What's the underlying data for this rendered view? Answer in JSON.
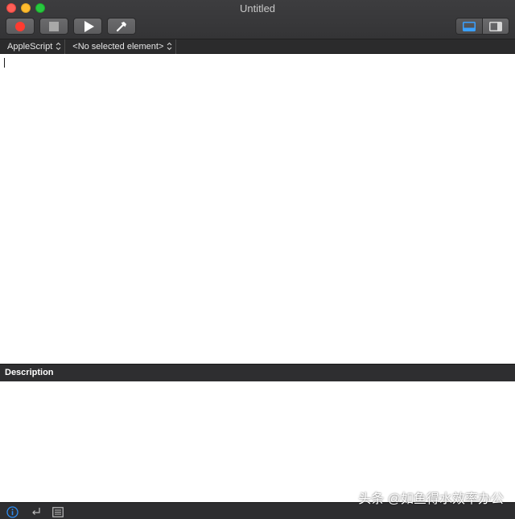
{
  "window": {
    "title": "Untitled"
  },
  "toolbar": {
    "record_icon": "record-icon",
    "stop_icon": "stop-icon",
    "run_icon": "play-icon",
    "compile_icon": "hammer-icon",
    "view_toggle_icons": [
      "bottom-pane-icon",
      "sidebar-pane-icon"
    ],
    "active_view": "bottom-pane"
  },
  "navigation": {
    "language": "AppleScript",
    "element": "<No selected element>"
  },
  "editor": {
    "content": ""
  },
  "description": {
    "header": "Description",
    "content": ""
  },
  "bottombar": {
    "icons": [
      "info-icon",
      "reply-icon",
      "log-icon"
    ],
    "active_icon": "info-icon"
  },
  "watermark": {
    "text": "头条 @如鱼得水效率办公"
  },
  "colors": {
    "accent": "#2d8cf0",
    "record": "#ff3b30",
    "traffic_close": "#ff5f57",
    "traffic_minimize": "#febc2e",
    "traffic_maximize": "#28c840"
  }
}
